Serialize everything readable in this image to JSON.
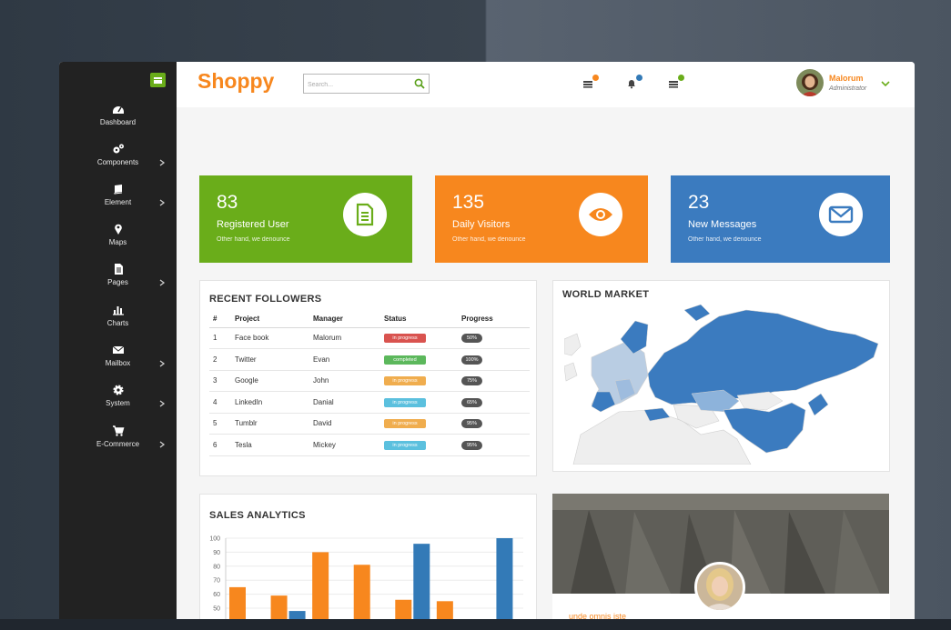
{
  "app": {
    "logo": "Shoppy"
  },
  "sidebar": {
    "items": [
      {
        "label": "Dashboard",
        "icon": "dashboard-icon",
        "has_submenu": false
      },
      {
        "label": "Components",
        "icon": "gears-icon",
        "has_submenu": true
      },
      {
        "label": "Element",
        "icon": "book-icon",
        "has_submenu": true
      },
      {
        "label": "Maps",
        "icon": "map-marker-icon",
        "has_submenu": false
      },
      {
        "label": "Pages",
        "icon": "file-icon",
        "has_submenu": true
      },
      {
        "label": "Charts",
        "icon": "bar-chart-icon",
        "has_submenu": false
      },
      {
        "label": "Mailbox",
        "icon": "envelope-icon",
        "has_submenu": true
      },
      {
        "label": "System",
        "icon": "gear-icon",
        "has_submenu": true
      },
      {
        "label": "E-Commerce",
        "icon": "cart-icon",
        "has_submenu": true
      }
    ]
  },
  "search": {
    "placeholder": "Search..."
  },
  "notifications": [
    {
      "icon": "messages-icon",
      "badge_color": "#f7871e"
    },
    {
      "icon": "bell-icon",
      "badge_color": "#337ab7"
    },
    {
      "icon": "tasks-icon",
      "badge_color": "#6aad1a"
    }
  ],
  "user": {
    "name": "Malorum",
    "role": "Administrator"
  },
  "stats": [
    {
      "value": "83",
      "title": "Registered User",
      "subtitle": "Other hand, we denounce",
      "color": "#6aad1a",
      "icon": "document-icon"
    },
    {
      "value": "135",
      "title": "Daily Visitors",
      "subtitle": "Other hand, we denounce",
      "color": "#f7871e",
      "icon": "eye-icon"
    },
    {
      "value": "23",
      "title": "New Messages",
      "subtitle": "Other hand, we denounce",
      "color": "#3b7bbf",
      "icon": "envelope-icon"
    }
  ],
  "followers": {
    "title": "RECENT FOLLOWERS",
    "columns": [
      "#",
      "Project",
      "Manager",
      "Status",
      "Progress"
    ],
    "rows": [
      {
        "n": "1",
        "project": "Face book",
        "manager": "Malorum",
        "status": "in progress",
        "status_color": "#d9534f",
        "progress": "50%"
      },
      {
        "n": "2",
        "project": "Twitter",
        "manager": "Evan",
        "status": "completed",
        "status_color": "#5cb85c",
        "progress": "100%"
      },
      {
        "n": "3",
        "project": "Google",
        "manager": "John",
        "status": "in progress",
        "status_color": "#f0ad4e",
        "progress": "75%"
      },
      {
        "n": "4",
        "project": "LinkedIn",
        "manager": "Danial",
        "status": "in progress",
        "status_color": "#5bc0de",
        "progress": "65%"
      },
      {
        "n": "5",
        "project": "Tumblr",
        "manager": "David",
        "status": "in progress",
        "status_color": "#f0ad4e",
        "progress": "95%"
      },
      {
        "n": "6",
        "project": "Tesla",
        "manager": "Mickey",
        "status": "in progress",
        "status_color": "#5bc0de",
        "progress": "95%"
      }
    ]
  },
  "world_market": {
    "title": "WORLD MARKET"
  },
  "sales": {
    "title": "SALES ANALYTICS"
  },
  "chart_data": {
    "type": "bar",
    "title": "SALES ANALYTICS",
    "ylim": [
      45,
      100
    ],
    "yticks": [
      "100",
      "90",
      "80",
      "70",
      "60",
      "50"
    ],
    "grid": true,
    "series": [
      {
        "color": "#f7871e",
        "values": [
          65,
          59,
          90,
          81,
          56,
          55,
          null
        ]
      },
      {
        "color": "#337ab7",
        "values": [
          null,
          48,
          null,
          null,
          96,
          null,
          100
        ]
      }
    ]
  },
  "profile_card": {
    "caption": "unde omnis iste"
  }
}
